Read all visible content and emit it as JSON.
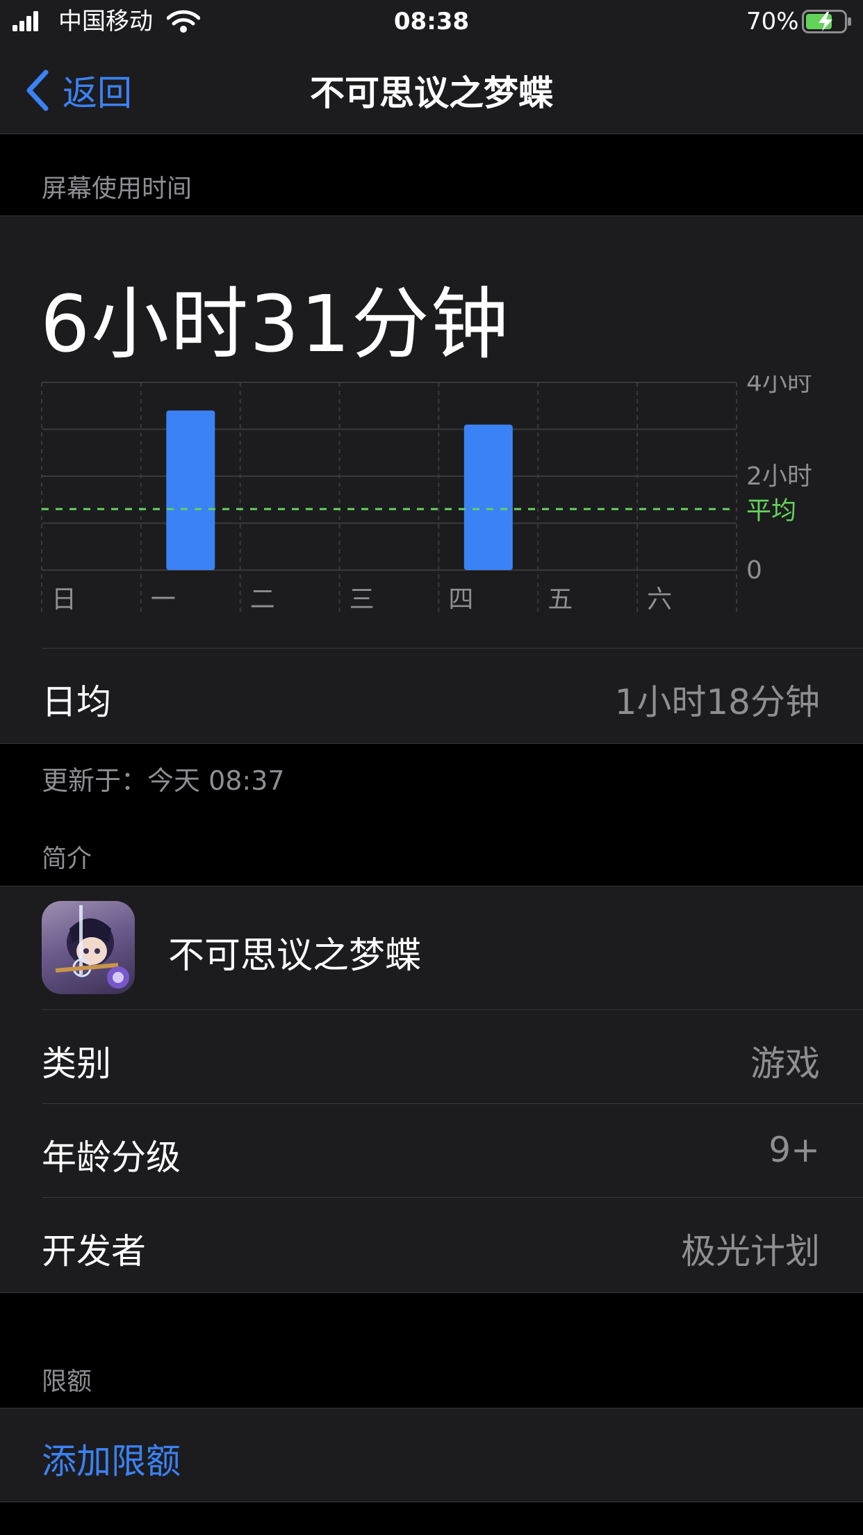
{
  "status_bar": {
    "carrier": "中国移动",
    "time": "08:38",
    "battery_percent": "70%",
    "battery_level": 0.7
  },
  "nav": {
    "back_label": "返回",
    "title": "不可思议之梦蝶"
  },
  "screen_time": {
    "section_header": "屏幕使用时间",
    "total": "6小时31分钟",
    "daily_avg_label": "日均",
    "daily_avg_value": "1小时18分钟",
    "updated": "更新于：今天 08:37"
  },
  "chart_data": {
    "type": "bar",
    "categories": [
      "日",
      "一",
      "二",
      "三",
      "四",
      "五",
      "六"
    ],
    "values": [
      0,
      3.4,
      0,
      0,
      3.1,
      0,
      0
    ],
    "ylim": [
      0,
      4
    ],
    "y_tick_labels": [
      "4小时",
      "2小时",
      "0"
    ],
    "average_label": "平均",
    "average_value": 1.3,
    "grid": true,
    "colors": {
      "bar": "#3b82f6",
      "average": "#63d25b",
      "grid": "#3a3a3c"
    }
  },
  "intro": {
    "section_header": "简介",
    "app_name": "不可思议之梦蝶",
    "rows": [
      {
        "label": "类别",
        "value": "游戏"
      },
      {
        "label": "年龄分级",
        "value": "9+"
      },
      {
        "label": "开发者",
        "value": "极光计划"
      }
    ]
  },
  "limits": {
    "section_header": "限额",
    "add_label": "添加限额"
  },
  "colors": {
    "accent": "#3b82f6",
    "background": "#000000",
    "card": "#1c1c1e"
  }
}
